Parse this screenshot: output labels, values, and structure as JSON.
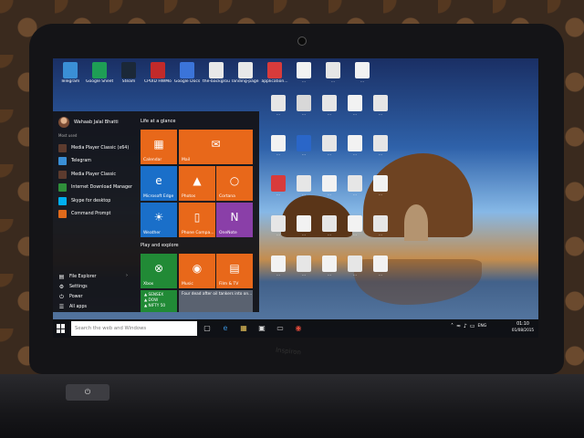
{
  "desktop": {
    "icons": [
      {
        "label": "Telegram",
        "color": "#3a8fd6"
      },
      {
        "label": "Google Sheets",
        "color": "#1e9e55"
      },
      {
        "label": "Steam",
        "color": "#1b2838"
      },
      {
        "label": "CPUID HWMonitor",
        "color": "#c22a2a"
      },
      {
        "label": "Google Docs",
        "color": "#3b74d9"
      },
      {
        "label": "the-background...",
        "color": "#e8e8e8"
      },
      {
        "label": "landing-page...",
        "color": "#e8e8e8"
      },
      {
        "label": "application...",
        "color": "#d83b3b"
      },
      {
        "label": "...",
        "color": "#f2f2f2"
      },
      {
        "label": "...",
        "color": "#e6e6e6"
      },
      {
        "label": "...",
        "color": "#f2f2f2"
      },
      {
        "label": "...",
        "color": "#e6e6e6"
      },
      {
        "label": "...",
        "color": "#d8d8d8"
      },
      {
        "label": "...",
        "color": "#e6e6e6"
      },
      {
        "label": "...",
        "color": "#f2f2f2"
      },
      {
        "label": "...",
        "color": "#e6e6e6"
      },
      {
        "label": "...",
        "color": "#f2f2f2"
      },
      {
        "label": "...",
        "color": "#2a66c8"
      },
      {
        "label": "...",
        "color": "#e6e6e6"
      },
      {
        "label": "...",
        "color": "#f2f2f2"
      },
      {
        "label": "...",
        "color": "#e6e6e6"
      },
      {
        "label": "...",
        "color": "#d83b3b"
      },
      {
        "label": "...",
        "color": "#e6e6e6"
      },
      {
        "label": "...",
        "color": "#f2f2f2"
      },
      {
        "label": "...",
        "color": "#e6e6e6"
      },
      {
        "label": "...",
        "color": "#f2f2f2"
      },
      {
        "label": "...",
        "color": "#e6e6e6"
      },
      {
        "label": "...",
        "color": "#f2f2f2"
      },
      {
        "label": "...",
        "color": "#e6e6e6"
      },
      {
        "label": "...",
        "color": "#f2f2f2"
      },
      {
        "label": "...",
        "color": "#e6e6e6"
      },
      {
        "label": "...",
        "color": "#f2f2f2"
      },
      {
        "label": "...",
        "color": "#e6e6e6"
      },
      {
        "label": "...",
        "color": "#f2f2f2"
      },
      {
        "label": "...",
        "color": "#e6e6e6"
      },
      {
        "label": "...",
        "color": "#f2f2f2"
      }
    ]
  },
  "start_menu": {
    "user_name": "Wahaab Jalal Bhatti",
    "most_used_label": "Most used",
    "apps": [
      {
        "label": "Media Player Classic (x64)",
        "color": "#5c3b2e"
      },
      {
        "label": "Telegram",
        "color": "#3a8fd6"
      },
      {
        "label": "Media Player Classic",
        "color": "#5c3b2e"
      },
      {
        "label": "Internet Download Manager",
        "color": "#2f8f3a"
      },
      {
        "label": "Skype for desktop",
        "color": "#00aff0"
      },
      {
        "label": "Command Prompt",
        "color": "#e06a1b"
      }
    ],
    "system": [
      {
        "label": "File Explorer",
        "icon": "folder-icon"
      },
      {
        "label": "Settings",
        "icon": "gear-icon"
      },
      {
        "label": "Power",
        "icon": "power-icon"
      },
      {
        "label": "All apps",
        "icon": "list-icon"
      }
    ],
    "groups": {
      "life": "Life at a glance",
      "play": "Play and explore"
    },
    "tiles": {
      "calendar": "Calendar",
      "mail": "Mail",
      "edge": "Microsoft Edge",
      "photos": "Photos",
      "cortana": "Cortana",
      "weather": "Weather",
      "phone": "Phone Compa...",
      "onenote": "OneNote",
      "xbox": "Xbox",
      "music": "Music",
      "film": "Film & TV",
      "news": "Four dead after oil tankers into on..."
    },
    "market_lines": [
      "SENSEX",
      "DOW",
      "NIFTY 50"
    ],
    "colors": {
      "orange": "#e8681a",
      "purple": "#8a3fa8",
      "green": "#218a36"
    }
  },
  "taskbar": {
    "search_placeholder": "Search the web and Windows",
    "tray_lang": "ENG",
    "time": "01:10",
    "date": "01/08/2015"
  },
  "device": {
    "brand": "Inspiron"
  }
}
